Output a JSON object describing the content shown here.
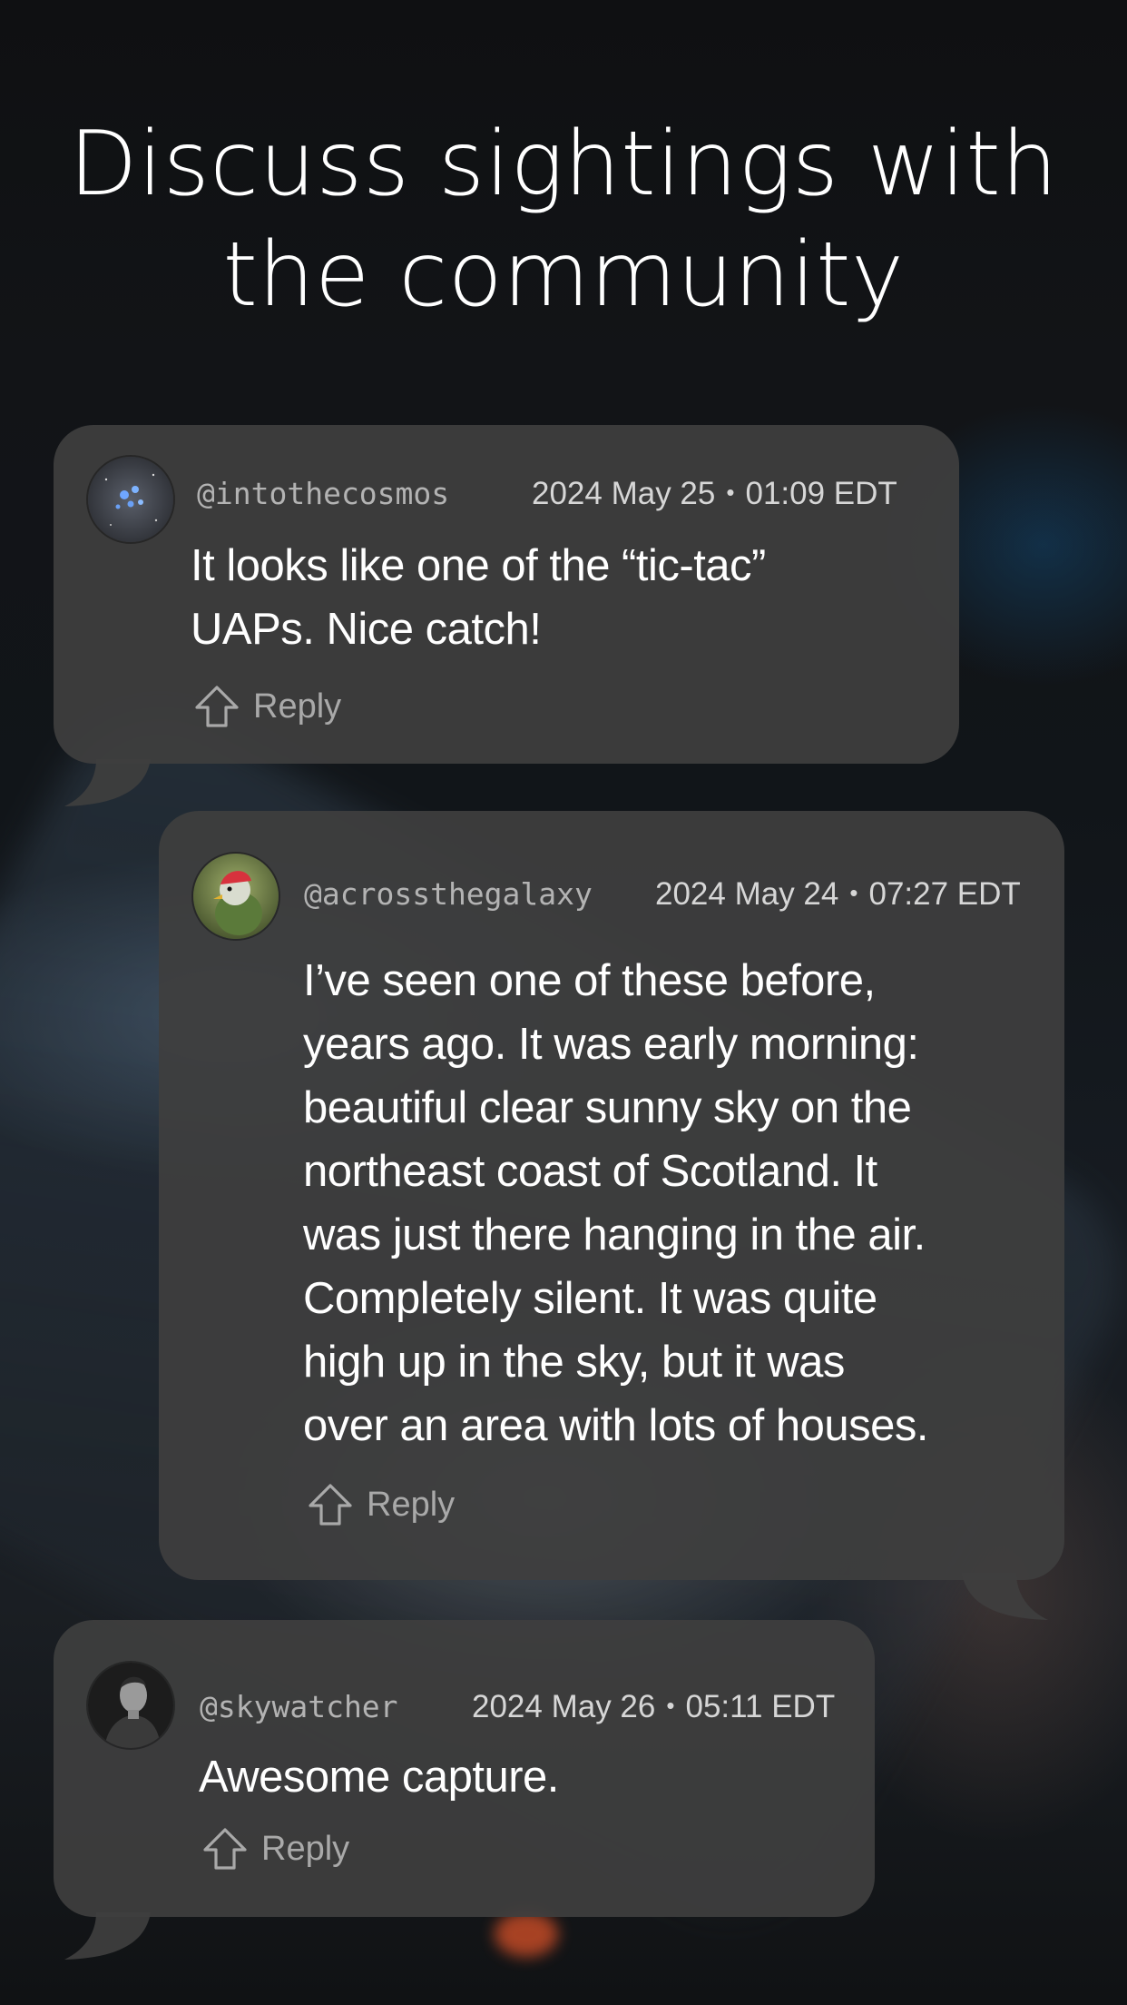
{
  "headline": {
    "line1": "Discuss sightings with",
    "line2": "the community"
  },
  "comments": [
    {
      "handle": "@intothecosmos",
      "date": "2024 May 25",
      "time": "01:09 EDT",
      "separator": "•",
      "body": [
        "It looks like one of the “tic-tac”",
        "UAPs.  Nice catch!"
      ],
      "reply_label": "Reply",
      "avatar": "star-cluster-avatar"
    },
    {
      "handle": "@acrossthegalaxy",
      "date": "2024 May 24",
      "time": "07:27 EDT",
      "separator": "•",
      "body": [
        "I’ve seen one of these before,",
        "years ago. It was early morning:",
        "beautiful clear sunny sky on the",
        "northeast coast of Scotland. It",
        "was just there hanging in the air.",
        "Completely silent. It was quite",
        "high up in the sky, but it was",
        "over an area with lots of houses."
      ],
      "reply_label": "Reply",
      "avatar": "bird-avatar"
    },
    {
      "handle": "@skywatcher",
      "date": "2024 May 26",
      "time": "05:11 EDT",
      "separator": "•",
      "body": [
        "Awesome capture."
      ],
      "reply_label": "Reply",
      "avatar": "person-portrait-avatar"
    }
  ],
  "colors": {
    "bubble": "#3e3e3e",
    "background": "#0d0e10",
    "text": "#ffffff",
    "muted": "#a9a9a9"
  }
}
